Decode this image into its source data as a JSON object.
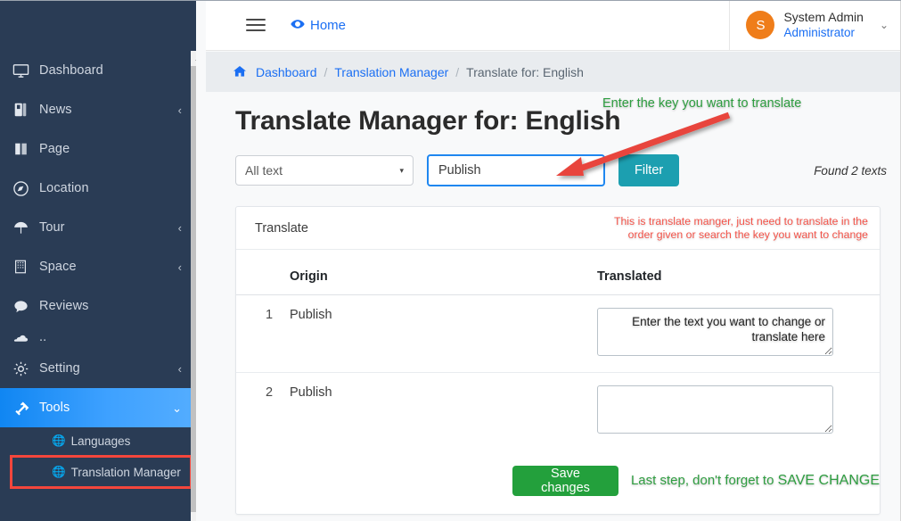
{
  "colors": {
    "sidebar_bg": "#2a3c55",
    "accent_blue": "#1b6ff3",
    "active_item": "#1086f2",
    "filter_teal": "#1c9fb0",
    "save_green": "#23a03c",
    "annotation_green": "#2f9e41",
    "annotation_red": "#f4544a",
    "highlight_box_red": "#f4463c",
    "avatar_orange": "#ef7d1a"
  },
  "sidebar": {
    "items": [
      {
        "label": "Dashboard",
        "icon": "monitor-icon",
        "caret": "",
        "active": false
      },
      {
        "label": "News",
        "icon": "book-icon",
        "caret": "‹",
        "active": false
      },
      {
        "label": "Page",
        "icon": "open-book-icon",
        "caret": "",
        "active": false
      },
      {
        "label": "Location",
        "icon": "compass-icon",
        "caret": "",
        "active": false
      },
      {
        "label": "Tour",
        "icon": "umbrella-icon",
        "caret": "‹",
        "active": false
      },
      {
        "label": "Space",
        "icon": "building-icon",
        "caret": "‹",
        "active": false
      },
      {
        "label": "Reviews",
        "icon": "comment-icon",
        "caret": "",
        "active": false
      },
      {
        "label": "..",
        "icon": "cloud-icon",
        "caret": "",
        "active": false
      },
      {
        "label": "Setting",
        "icon": "gear-icon",
        "caret": "‹",
        "active": false
      },
      {
        "label": "Tools",
        "icon": "hammer-icon",
        "caret": "⌄",
        "active": true
      }
    ],
    "sub_items": [
      {
        "label": "Languages",
        "icon": "globe-icon",
        "highlighted": false
      },
      {
        "label": "Translation Manager",
        "icon": "globe-icon",
        "highlighted": true
      }
    ]
  },
  "header": {
    "menu_toggle": "hamburger-icon",
    "home_label": "Home",
    "home_icon": "eye-icon",
    "user": {
      "avatar_initial": "S",
      "name": "System Admin",
      "role": "Administrator",
      "caret": "⌄"
    }
  },
  "breadcrumb": {
    "home_icon": "home-icon",
    "items": [
      {
        "label": "Dashboard",
        "link": true
      },
      {
        "label": "Translation Manager",
        "link": true
      },
      {
        "label": "Translate for: English",
        "link": false
      }
    ],
    "separator": "/"
  },
  "main": {
    "page_title": "Translate Manager for: English",
    "filter": {
      "select_value": "All text",
      "select_caret": "▾",
      "search_value": "Publish",
      "search_placeholder": "",
      "filter_button": "Filter",
      "found_text": "Found 2 texts"
    },
    "card": {
      "title": "Translate",
      "columns": {
        "num": "",
        "origin": "Origin",
        "translated": "Translated"
      },
      "rows": [
        {
          "num": "1",
          "origin": "Publish",
          "translated": "Enter the text you want to change or translate here"
        },
        {
          "num": "2",
          "origin": "Publish",
          "translated": ""
        }
      ],
      "save_button": "Save changes"
    }
  },
  "annotations": {
    "key_hint": "Enter the key you want to translate",
    "card_hint_line1": "This is translate manger, just need to translate  in the",
    "card_hint_line2": "order given or search the key you want to change",
    "save_hint_prefix": "Last step, don't forget to ",
    "save_hint_caps": "SAVE CHANGE",
    "arrow": "red-arrow-icon"
  }
}
